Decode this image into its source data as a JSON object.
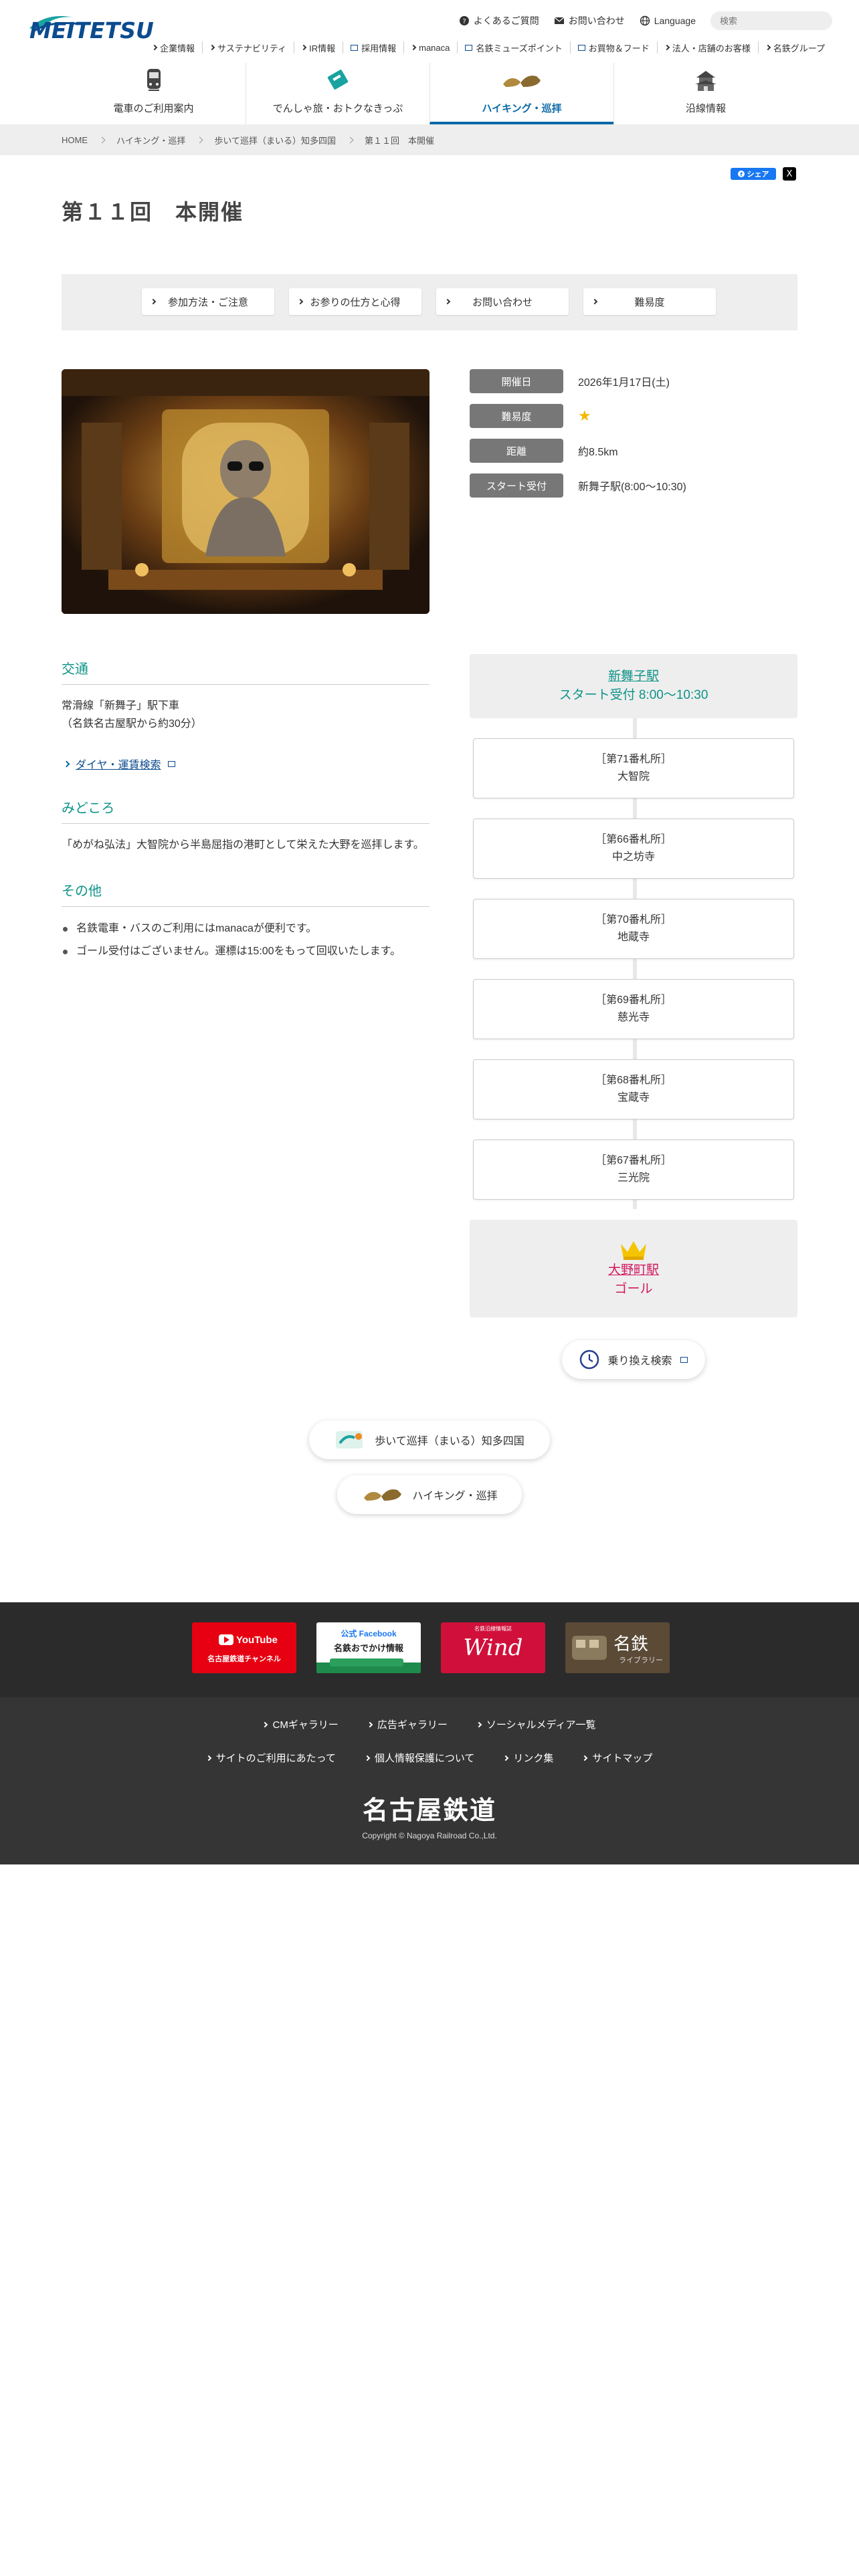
{
  "header": {
    "logo_text": "MEITETSU",
    "util": {
      "faq": "よくあるご質問",
      "contact": "お問い合わせ",
      "language": "Language",
      "search_placeholder": "検索"
    },
    "subnav": [
      "企業情報",
      "サステナビリティ",
      "IR情報",
      "採用情報",
      "manaca",
      "名鉄ミューズポイント",
      "お買物＆フード",
      "法人・店舗のお客様",
      "名鉄グループ"
    ],
    "gnav": [
      {
        "label": "電車のご利用案内",
        "icon": "train-icon"
      },
      {
        "label": "でんしゃ旅・おトクなきっぷ",
        "icon": "ticket-icon"
      },
      {
        "label": "ハイキング・巡拝",
        "icon": "hiking-shoes-icon",
        "active": true
      },
      {
        "label": "沿線情報",
        "icon": "castle-icon"
      }
    ]
  },
  "breadcrumb": [
    "HOME",
    "ハイキング・巡拝",
    "歩いて巡拝（まいる）知多四国",
    "第１１回　本開催"
  ],
  "share": {
    "facebook": "シェア",
    "x": "X"
  },
  "page_title": "第１１回　本開催",
  "tabs": [
    "参加方法・ご注意",
    "お参りの仕方と心得",
    "お問い合わせ",
    "難易度"
  ],
  "info": {
    "date_label": "開催日",
    "date_value": "2026年1月17日(土)",
    "difficulty_label": "難易度",
    "difficulty_stars": "★",
    "distance_label": "距離",
    "distance_value": "約8.5km",
    "start_label": "スタート受付",
    "start_value": "新舞子駅(8:00〜10:30)"
  },
  "details": {
    "access_title": "交通",
    "access_text_1": "常滑線「新舞子」駅下車",
    "access_text_2": "（名鉄名古屋駅から約30分）",
    "access_link": "ダイヤ・運賃検索",
    "highlight_title": "みどころ",
    "highlight_text": "「めがね弘法」大智院から半島屈指の港町として栄えた大野を巡拝します。",
    "other_title": "その他",
    "other_items": [
      "名鉄電車・バスのご利用にはmanacaが便利です。",
      "ゴール受付はございません。運標は15:00をもって回収いたします。"
    ]
  },
  "route": {
    "start_station": "新舞子駅",
    "start_time": "スタート受付 8:00〜10:30",
    "stops": [
      {
        "no": "［第71番札所］",
        "name": "大智院"
      },
      {
        "no": "［第66番札所］",
        "name": "中之坊寺"
      },
      {
        "no": "［第70番札所］",
        "name": "地蔵寺"
      },
      {
        "no": "［第69番札所］",
        "name": "慈光寺"
      },
      {
        "no": "［第68番札所］",
        "name": "宝蔵寺"
      },
      {
        "no": "［第67番札所］",
        "name": "三光院"
      }
    ],
    "goal_station": "大野町駅",
    "goal_label": "ゴール"
  },
  "buttons": {
    "transfer": "乗り換え検索",
    "back_shikoku": "歩いて巡拝（まいる）知多四国",
    "back_hiking": "ハイキング・巡拝"
  },
  "footer": {
    "banners": [
      {
        "title": "YouTube",
        "sub": "名古屋鉄道チャンネル"
      },
      {
        "title": "公式 Facebook",
        "sub": "名鉄おでかけ情報"
      },
      {
        "title": "Wind",
        "sub": "名鉄沿線情報誌"
      },
      {
        "title": "名鉄",
        "sub": "ライブラリー"
      }
    ],
    "links_row1": [
      "CMギャラリー",
      "広告ギャラリー",
      "ソーシャルメディア一覧"
    ],
    "links_row2": [
      "サイトのご利用にあたって",
      "個人情報保護について",
      "リンク集",
      "サイトマップ"
    ],
    "logo": "名古屋鉄道",
    "copyright": "Copyright © Nagoya Railroad Co.,Ltd."
  },
  "colors": {
    "brand": "#0b4b8f",
    "teal": "#0d9488",
    "goal": "#d1175c",
    "footer": "#353535"
  }
}
